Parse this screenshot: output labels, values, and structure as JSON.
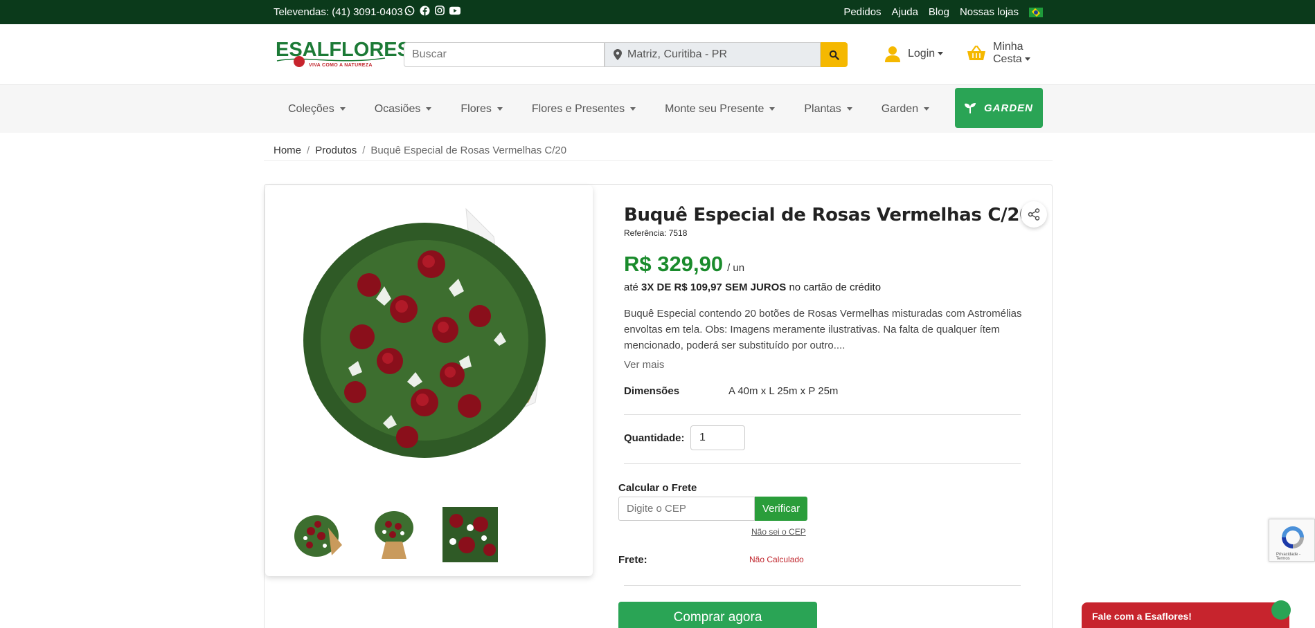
{
  "topbar": {
    "phone": "Televendas: (41) 3091-0403",
    "socials": [
      "whatsapp-icon",
      "facebook-icon",
      "instagram-icon",
      "youtube-icon"
    ],
    "links": [
      "Pedidos",
      "Ajuda",
      "Blog",
      "Nossas lojas"
    ],
    "background": "#0b3a1b"
  },
  "header": {
    "logo_text": "ESALFLORES",
    "logo_tagline": "VIVA COMO A NATUREZA",
    "search_placeholder": "Buscar",
    "location": "Matriz, Curitiba - PR",
    "login_label": "Login",
    "basket_label_line1": "Minha",
    "basket_label_line2": "Cesta"
  },
  "nav": {
    "items": [
      "Coleções",
      "Ocasiões",
      "Flores",
      "Flores e Presentes",
      "Monte seu Presente",
      "Plantas",
      "Garden"
    ],
    "garden_button": "GARDEN"
  },
  "breadcrumb": {
    "home": "Home",
    "products": "Produtos",
    "current": "Buquê Especial de Rosas Vermelhas C/20"
  },
  "product": {
    "title": "Buquê Especial de Rosas Vermelhas C/20",
    "reference": "Referência: 7518",
    "price": "R$ 329,90",
    "price_unit": "/ un",
    "installments_prefix": "até",
    "installments_bold": "3X DE R$ 109,97 SEM JUROS",
    "installments_suffix": "no cartão de crédito",
    "description": "Buquê Especial contendo 20 botões de Rosas Vermelhas misturadas com Astromélias envoltas em tela. Obs: Imagens meramente ilustrativas. Na falta de qualquer ítem mencionado, poderá ser substituído por outro....",
    "see_more": "Ver mais",
    "dimensions_label": "Dimensões",
    "dimensions_value": "A 40m x L 25m x P 25m",
    "quantity_label": "Quantidade:",
    "quantity_value": "1",
    "shipping_title": "Calcular o Frete",
    "cep_placeholder": "Digite o CEP",
    "verify_button": "Verificar",
    "dont_know_cep": "Não sei o CEP",
    "shipping_label": "Frete:",
    "shipping_value": "Não Calculado",
    "buy_button": "Comprar agora"
  },
  "widgets": {
    "recaptcha_text": "Privacidade - Termos",
    "chat_label": "Fale com a Esaflores!"
  },
  "colors": {
    "brand_green": "#1a8b2c",
    "button_green": "#2aa455",
    "accent_yellow": "#f5b800",
    "accent_red": "#c7242d"
  }
}
